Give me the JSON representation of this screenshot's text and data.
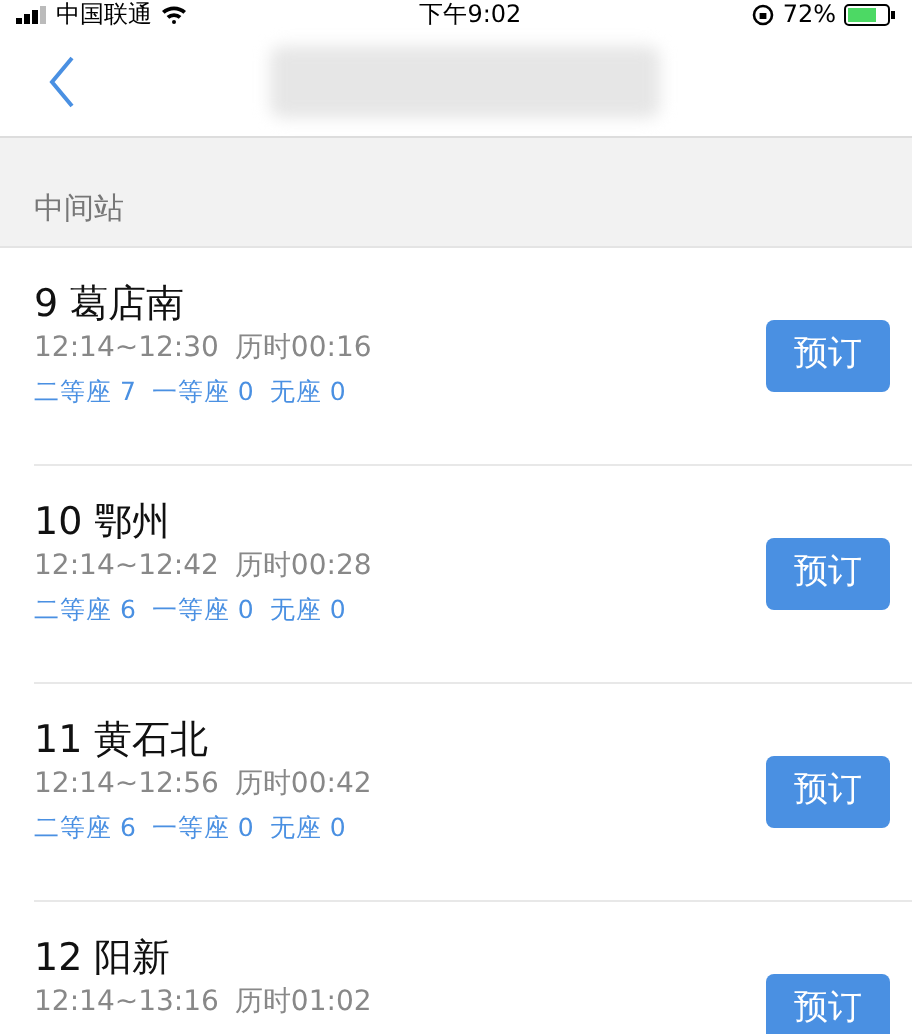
{
  "status_bar": {
    "carrier": "中国联通",
    "time": "下午9:02",
    "battery": "72%"
  },
  "section_header": "中间站",
  "stations": [
    {
      "name": "9 葛店南",
      "time": "12:14~12:30",
      "duration": "历时00:16",
      "seats": [
        "二等座 7",
        "一等座 0",
        "无座 0"
      ],
      "button": "预订"
    },
    {
      "name": "10 鄂州",
      "time": "12:14~12:42",
      "duration": "历时00:28",
      "seats": [
        "二等座 6",
        "一等座 0",
        "无座 0"
      ],
      "button": "预订"
    },
    {
      "name": "11 黄石北",
      "time": "12:14~12:56",
      "duration": "历时00:42",
      "seats": [
        "二等座 6",
        "一等座 0",
        "无座 0"
      ],
      "button": "预订"
    },
    {
      "name": "12 阳新",
      "time": "12:14~13:16",
      "duration": "历时01:02",
      "button": "预订"
    }
  ]
}
